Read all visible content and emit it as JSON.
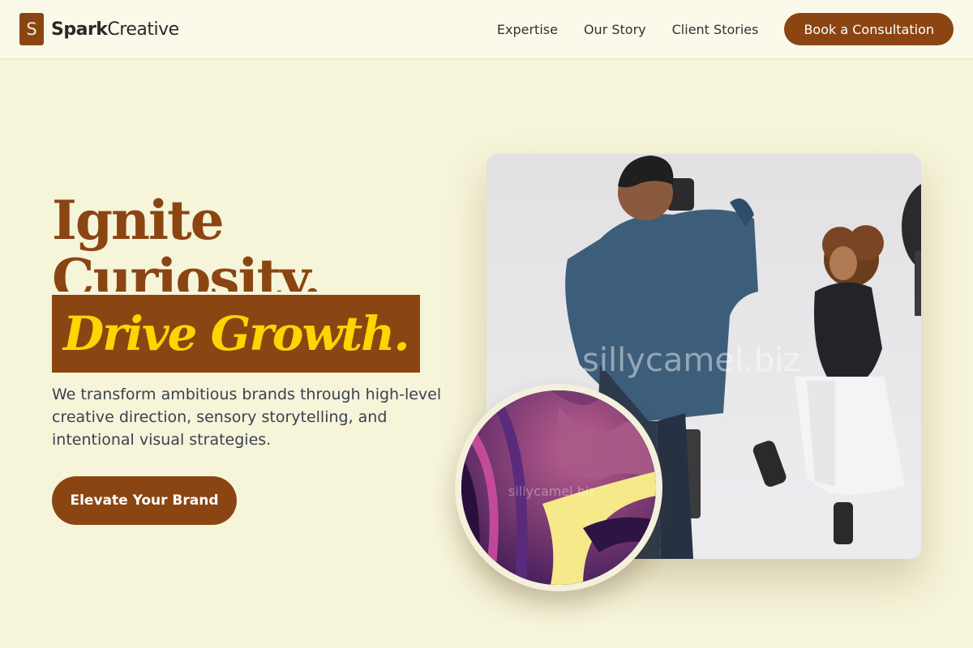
{
  "header": {
    "logo_letter": "S",
    "brand_bold": "Spark",
    "brand_light": "Creative",
    "nav": [
      "Expertise",
      "Our Story",
      "Client Stories"
    ],
    "cta_label": "Book a Consultation"
  },
  "hero": {
    "title_line1": "Ignite",
    "title_line2": "Curiosity.",
    "highlight": "Drive Growth.",
    "subtitle": "We transform ambitious brands through high-level creative direction, sensory storytelling, and intentional visual strategies.",
    "button_label": "Elevate Your Brand"
  },
  "images": {
    "photo_watermark": "sillycamel.biz",
    "circle_watermark": "sillycamel.biz"
  },
  "colors": {
    "accent": "#8b4513",
    "highlight_text": "#ffd400",
    "background": "#f6f4d9"
  }
}
